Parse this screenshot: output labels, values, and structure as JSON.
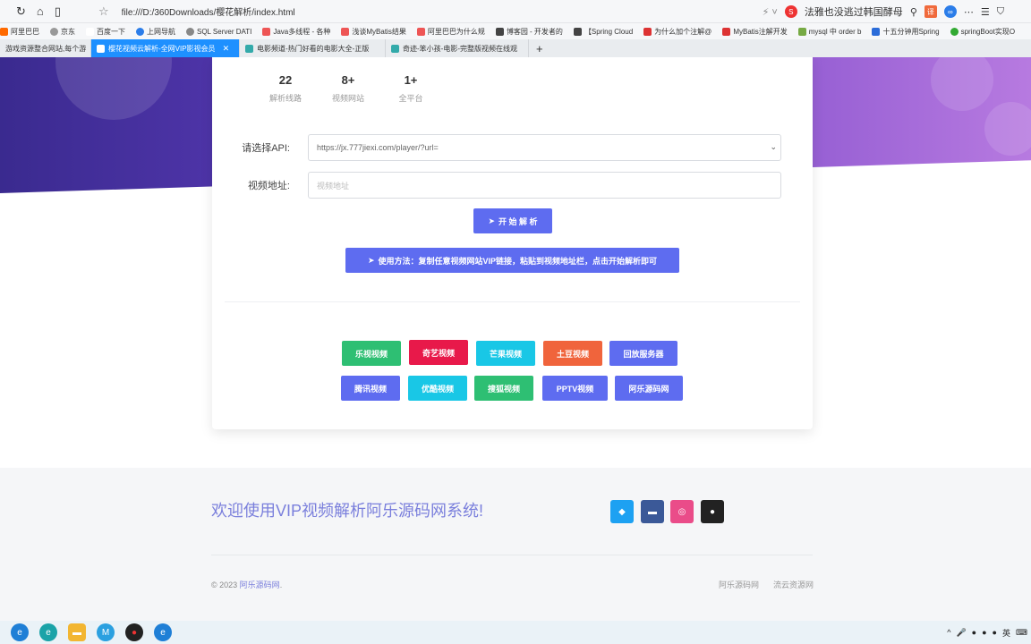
{
  "browser": {
    "url": "file:///D:/360Downloads/樱花解析/index.html",
    "right_text": "法雅也没逃过韩国酵母"
  },
  "bookmarks": [
    {
      "label": "阿里巴巴",
      "color": "#ff6a00"
    },
    {
      "label": "京东",
      "color": "#999"
    },
    {
      "label": "百度一下",
      "color": "#fff"
    },
    {
      "label": "上网导航",
      "color": "#2b7de9"
    },
    {
      "label": "SQL Server DATI",
      "color": "#888"
    },
    {
      "label": "Java多线程 - 各种",
      "color": "#e55"
    },
    {
      "label": "浅谈MyBatis结果",
      "color": "#e55"
    },
    {
      "label": "阿里巴巴为什么规",
      "color": "#e55"
    },
    {
      "label": "博客园 - 开发者的",
      "color": "#444"
    },
    {
      "label": "【Spring Cloud",
      "color": "#444"
    },
    {
      "label": "为什么加个注解@",
      "color": "#d33"
    },
    {
      "label": "MyBatis注解开发",
      "color": "#d33"
    },
    {
      "label": "mysql 中 order b",
      "color": "#7a4"
    },
    {
      "label": "十五分钟用Spring",
      "color": "#2b6cd9"
    },
    {
      "label": "springBoot实现O",
      "color": "#3a3"
    }
  ],
  "tabs": [
    {
      "label": "游戏资源整合网站,每个游",
      "active": false
    },
    {
      "label": "樱花视频云解析-全网VIP影视会员",
      "active": true
    },
    {
      "label": "电影频道-热门好看的电影大全-正版",
      "active": false
    },
    {
      "label": "奇迹-笨小孩-电影-完整版视频在线观",
      "active": false
    }
  ],
  "stats": [
    {
      "num": "22",
      "label": "解析线路"
    },
    {
      "num": "8+",
      "label": "视频网站"
    },
    {
      "num": "1+",
      "label": "全平台"
    }
  ],
  "form": {
    "api_label": "请选择API:",
    "api_value": "https://jx.777jiexi.com/player/?url=",
    "video_label": "视频地址:",
    "video_placeholder": "视频地址"
  },
  "buttons": {
    "start": "开 始 解 析",
    "usage": "使用方法：复制任意视频网站VIP链接，粘贴到视频地址栏，点击开始解析即可"
  },
  "sites_row1": [
    {
      "label": "乐视视频",
      "color": "#2ebf73"
    },
    {
      "label": "奇艺视频",
      "color": "#e8194a"
    },
    {
      "label": "芒果视频",
      "color": "#19c7e6"
    },
    {
      "label": "土豆视频",
      "color": "#f0643c"
    },
    {
      "label": "回放服务器",
      "color": "#5e6cf0"
    }
  ],
  "sites_row2": [
    {
      "label": "腾讯视频",
      "color": "#5e6cf0"
    },
    {
      "label": "优酷视频",
      "color": "#19c7e6"
    },
    {
      "label": "搜狐视频",
      "color": "#2ebf73"
    },
    {
      "label": "PPTV视频",
      "color": "#5e6cf0"
    },
    {
      "label": "阿乐源码网",
      "color": "#5e6cf0"
    }
  ],
  "footer": {
    "welcome": "欢迎使用VIP视频解析阿乐源码网系统!",
    "copyright_prefix": "© 2023",
    "copyright_link": "阿乐源码网",
    "copyright_suffix": ".",
    "links": [
      "阿乐源码网",
      "流云资源网"
    ]
  },
  "tray": {
    "ime": "英"
  }
}
